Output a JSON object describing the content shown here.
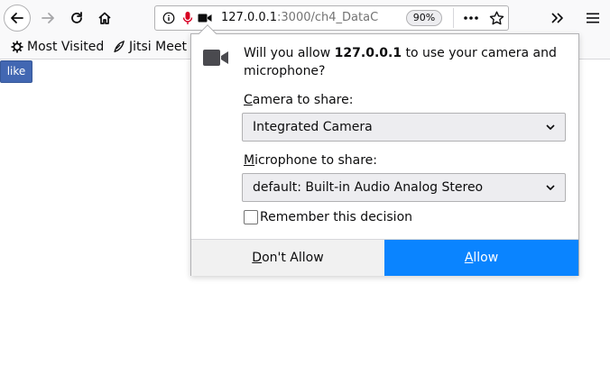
{
  "toolbar": {
    "back_icon": "arrow-left-icon",
    "forward_icon": "arrow-right-icon",
    "reload_icon": "reload-icon",
    "home_icon": "home-icon",
    "url_host": "127.0.0.1",
    "url_rest": ":3000/ch4_DataC",
    "zoom_level": "90%",
    "page_actions_icon": "more-horizontal-icon",
    "bookmark_star_icon": "star-icon",
    "overflow_icon": "chevron-double-right-icon",
    "menu_icon": "hamburger-menu-icon"
  },
  "bookmarks": {
    "items": [
      {
        "label": "Most Visited",
        "icon": "gear-icon"
      },
      {
        "label": "Jitsi Meet",
        "icon": "feather-icon"
      }
    ]
  },
  "page": {
    "like_label": "like"
  },
  "permission_popup": {
    "message_prefix": "Will you allow ",
    "message_host": "127.0.0.1",
    "message_suffix": " to use your camera and microphone?",
    "camera_label_key": "C",
    "camera_label_rest": "amera to share:",
    "camera_selected": "Integrated Camera",
    "mic_label_key": "M",
    "mic_label_rest": "icrophone to share:",
    "mic_selected": "default: Built-in Audio Analog Stereo",
    "remember_label": "Remember this decision",
    "remember_checked": false,
    "dont_allow_key": "D",
    "dont_allow_rest": "on't Allow",
    "allow_key": "A",
    "allow_rest": "llow",
    "accent_color": "#0a84ff"
  }
}
